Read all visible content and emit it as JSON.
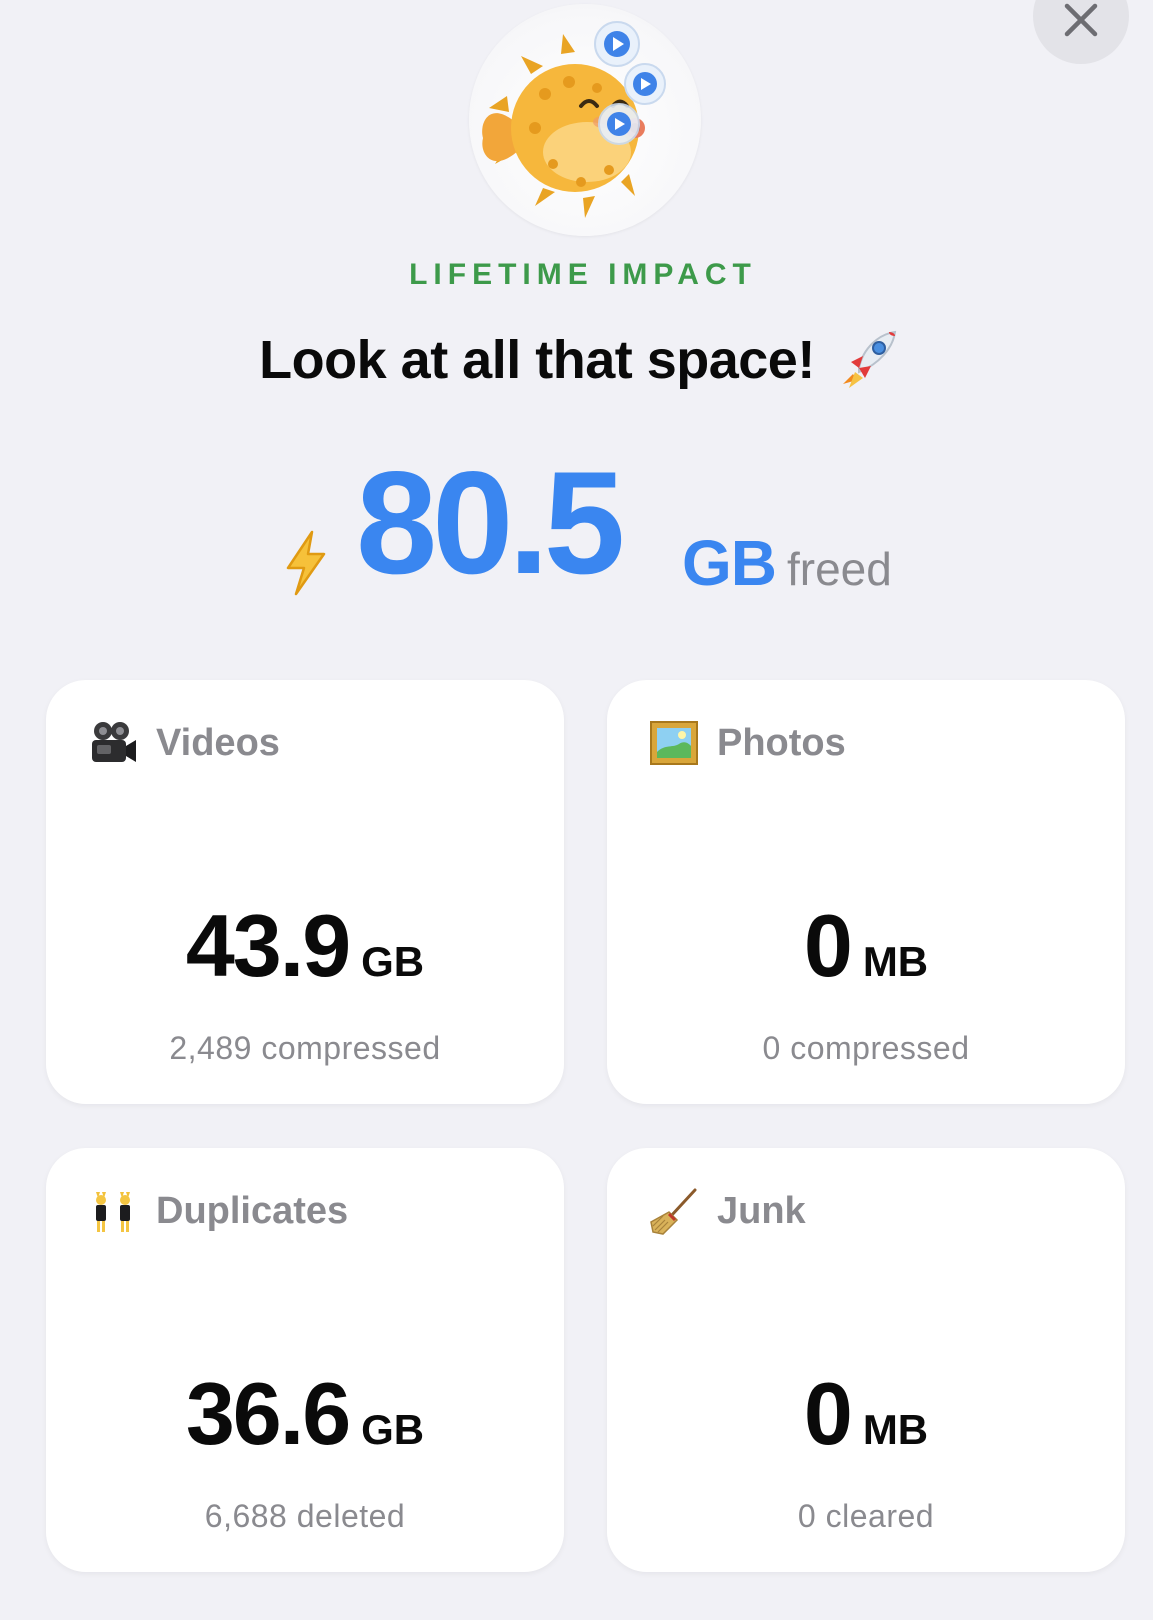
{
  "header": {
    "close_label": "Close",
    "eyebrow": "LIFETIME IMPACT",
    "headline": "Look at all that space!",
    "headline_icon": "rocket-icon",
    "mascot_icon": "pufferfish-mascot"
  },
  "hero": {
    "icon": "lightning-bolt-icon",
    "value": "80.5",
    "unit": "GB",
    "suffix": "freed"
  },
  "colors": {
    "background": "#f1f1f6",
    "accent_blue": "#3a86f0",
    "accent_green": "#3d9a4a",
    "muted_text": "#8a8a8f",
    "card_bg": "#ffffff"
  },
  "cards": [
    {
      "title": "Videos",
      "icon": "movie-camera-icon",
      "value": "43.9",
      "unit": "GB",
      "subtitle": "2,489 compressed"
    },
    {
      "title": "Photos",
      "icon": "framed-picture-icon",
      "value": "0",
      "unit": "MB",
      "subtitle": "0 compressed"
    },
    {
      "title": "Duplicates",
      "icon": "twins-icon",
      "value": "36.6",
      "unit": "GB",
      "subtitle": "6,688 deleted"
    },
    {
      "title": "Junk",
      "icon": "broom-icon",
      "value": "0",
      "unit": "MB",
      "subtitle": "0 cleared"
    }
  ]
}
